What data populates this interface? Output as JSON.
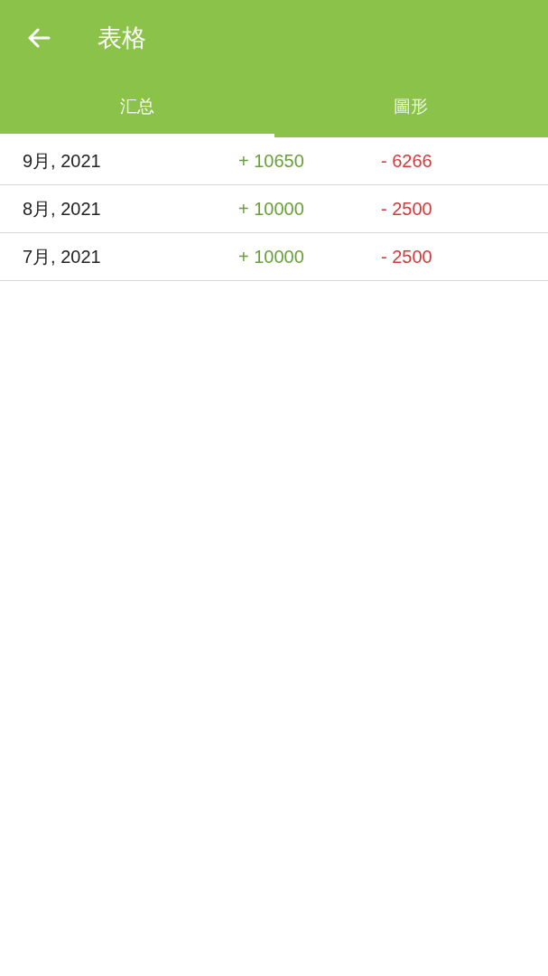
{
  "header": {
    "title": "表格"
  },
  "tabs": [
    {
      "label": "汇总",
      "selected": true
    },
    {
      "label": "圖形",
      "selected": false
    }
  ],
  "rows": [
    {
      "month": "9月, 2021",
      "income": "+ 10650",
      "expense": "- 6266"
    },
    {
      "month": "8月, 2021",
      "income": "+ 10000",
      "expense": "- 2500"
    },
    {
      "month": "7月, 2021",
      "income": "+ 10000",
      "expense": "- 2500"
    }
  ]
}
